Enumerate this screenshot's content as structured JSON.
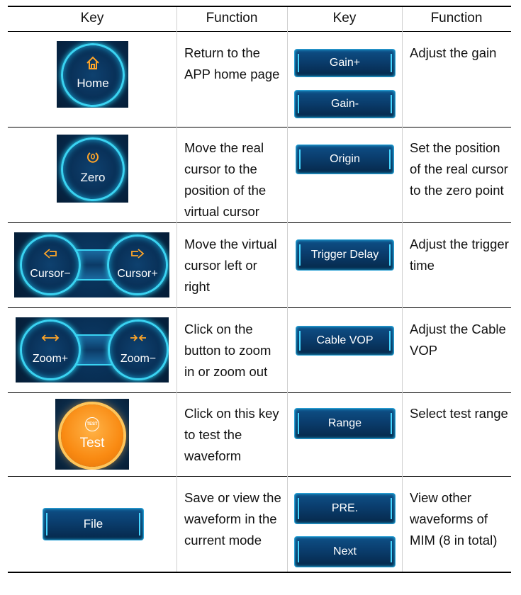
{
  "table": {
    "headers": [
      "Key",
      "Function",
      "Key",
      "Function"
    ],
    "rows": [
      {
        "left_key": {
          "icon": "home-icon",
          "label": "Home"
        },
        "left_function": "Return to the APP home page",
        "right_keys": [
          "Gain+",
          "Gain-"
        ],
        "right_function": "Adjust the gain"
      },
      {
        "left_key": {
          "icon": "zero-icon",
          "label": "Zero"
        },
        "left_function": "Move the real cursor to the position of the virtual cursor",
        "right_keys": [
          "Origin"
        ],
        "right_function": "Set the position of the real cursor to the zero point"
      },
      {
        "left_key": {
          "icons": [
            "arrow-left-icon",
            "arrow-right-icon"
          ],
          "labels": [
            "Cursor−",
            "Cursor+"
          ]
        },
        "left_function": "Move the virtual cursor left or right",
        "right_keys": [
          "Trigger Delay"
        ],
        "right_function": "Adjust the trigger time"
      },
      {
        "left_key": {
          "icons": [
            "zoom-in-icon",
            "zoom-out-icon"
          ],
          "labels": [
            "Zoom+",
            "Zoom−"
          ]
        },
        "left_function": "Click on the button to zoom in or zoom out",
        "right_keys": [
          "Cable VOP"
        ],
        "right_function": "Adjust the Cable VOP"
      },
      {
        "left_key": {
          "icon": "test-icon",
          "icon_text": "TEST",
          "label": "Test"
        },
        "left_function": "Click on this key to test the waveform",
        "right_keys": [
          "Range"
        ],
        "right_function": "Select test range"
      },
      {
        "left_key": {
          "label": "File"
        },
        "left_function": "Save or view the waveform in the current mode",
        "right_keys": [
          "PRE.",
          "Next"
        ],
        "right_function": "View other waveforms of MIM (8 in total)"
      }
    ]
  },
  "colors": {
    "accent_cyan": "#3ad3f2",
    "tile_bg": "#072a4d",
    "test_orange": "#f98a12",
    "icon_orange": "#ffa528"
  }
}
